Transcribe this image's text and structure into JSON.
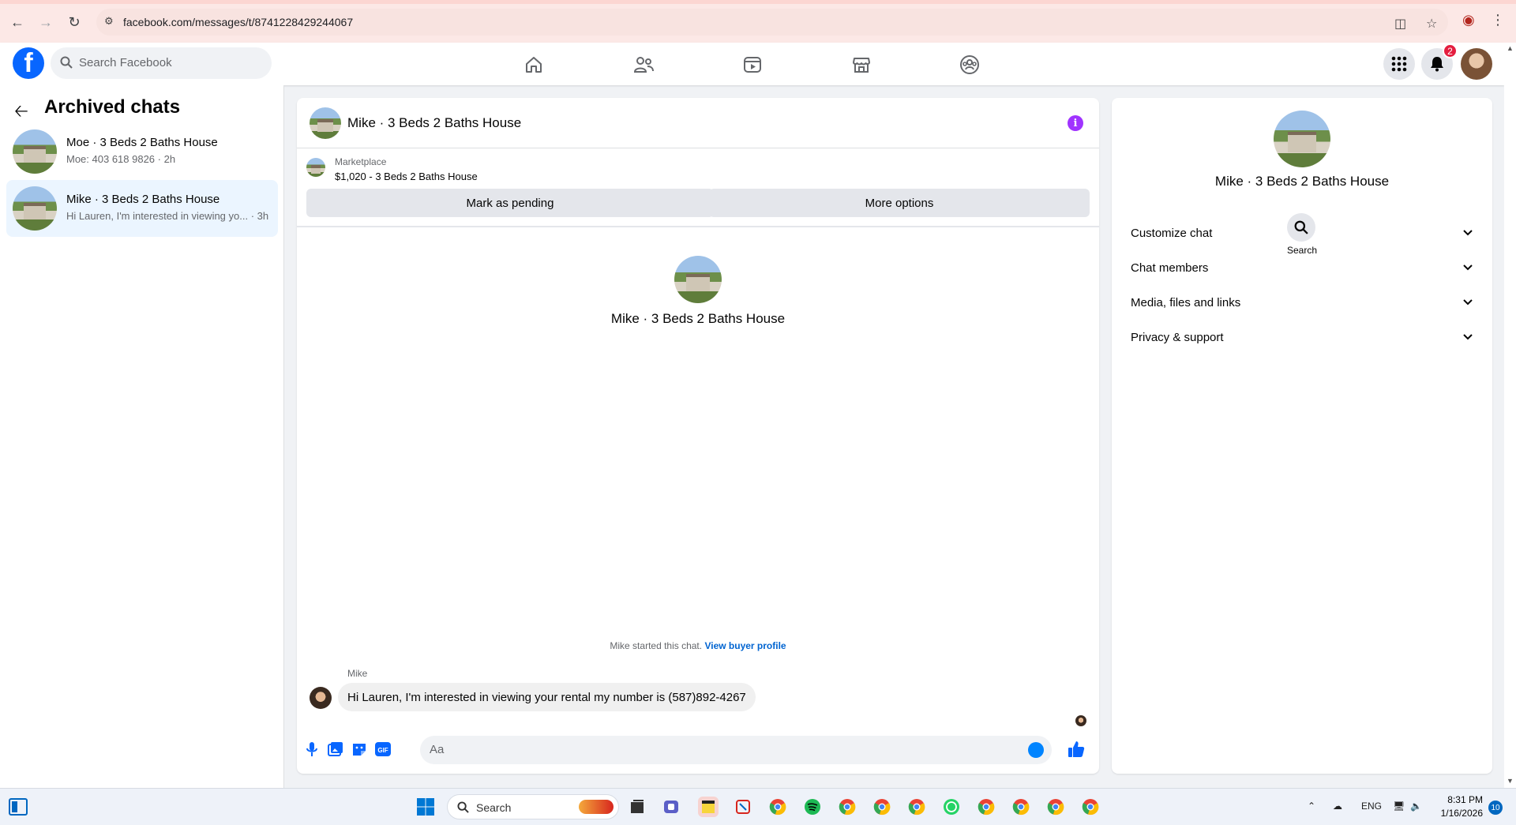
{
  "browser": {
    "url": "facebook.com/messages/t/8741228429244067"
  },
  "header": {
    "search_placeholder": "Search Facebook",
    "notification_count": "2",
    "nav_icons": [
      "home-icon",
      "friends-icon",
      "video-icon",
      "marketplace-icon",
      "groups-icon"
    ]
  },
  "sidebar": {
    "title": "Archived chats",
    "chats": [
      {
        "name": "Moe · 3 Beds 2 Baths House",
        "snippet": "Moe: 403 618 9826 · 2h"
      },
      {
        "name": "Mike · 3 Beds 2 Baths House",
        "snippet": "Hi Lauren, I'm interested in viewing yo... · 3h"
      }
    ]
  },
  "conversation": {
    "title": "Mike · 3 Beds 2 Baths House",
    "marketplace_label": "Marketplace",
    "marketplace_item": "$1,020 - 3 Beds 2 Baths House",
    "mark_pending_label": "Mark as pending",
    "more_options_label": "More options",
    "hero_name": "Mike · 3 Beds 2 Baths House",
    "started_text": "Mike started this chat.",
    "view_profile_label": "View buyer profile",
    "sender_name": "Mike",
    "message": "Hi Lauren, I'm interested in viewing your rental my number is (587)892-4267",
    "composer_placeholder": "Aa"
  },
  "right_panel": {
    "name": "Mike · 3 Beds 2 Baths House",
    "search_label": "Search",
    "sections": [
      "Customize chat",
      "Chat members",
      "Media, files and links",
      "Privacy & support"
    ]
  },
  "taskbar": {
    "search_label": "Search",
    "language": "ENG",
    "time": "8:31 PM",
    "date": "1/16/2026",
    "notification_count": "10"
  },
  "colors": {
    "fb_blue": "#0866ff",
    "active_chat_bg": "#ebf5ff",
    "info_purple": "#a033ff",
    "link_blue": "#0064d1"
  }
}
